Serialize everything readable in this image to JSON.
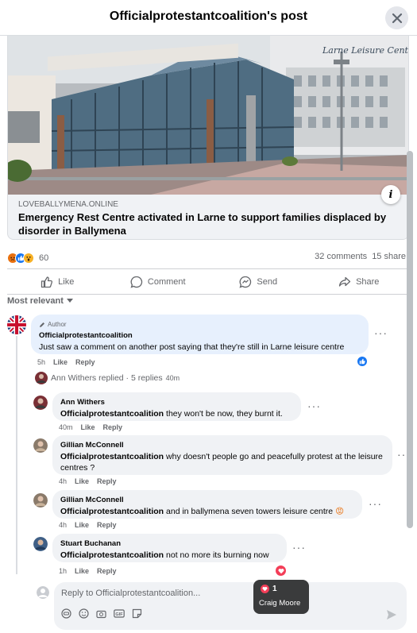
{
  "header": {
    "title": "Officialprotestantcoalition's post"
  },
  "card": {
    "image_sign": "Larne Leisure Centre",
    "domain": "LOVEBALLYMENA.ONLINE",
    "headline": "Emergency Rest Centre activated in Larne to support families displaced by disorder in Ballymena"
  },
  "reactions": {
    "count": "60",
    "comments": "32 comments",
    "shares": "15 share",
    "types": [
      "angry",
      "like",
      "wow"
    ]
  },
  "actions": {
    "like": "Like",
    "comment": "Comment",
    "send": "Send",
    "share": "Share"
  },
  "sort": {
    "label": "Most relevant"
  },
  "comments": [
    {
      "badge": "Author",
      "name": "Officialprotestantcoalition",
      "text": "Just saw a comment on another post saying that they're still in Larne leisure centre",
      "time": "5h",
      "like": "Like",
      "reply": "Reply"
    }
  ],
  "replies_summary": {
    "text": "Ann Withers replied · 5 replies",
    "time": "40m"
  },
  "replies": [
    {
      "name": "Ann Withers",
      "mention": "Officialprotestantcoalition",
      "text": " they won't be now, they burnt it.",
      "time": "40m",
      "like": "Like",
      "reply": "Reply"
    },
    {
      "name": "Gillian McConnell",
      "mention": "Officialprotestantcoalition",
      "text": " why doesn't people go and peacefully protest at the leisure centres ?",
      "time": "4h",
      "like": "Like",
      "reply": "Reply"
    },
    {
      "name": "Gillian McConnell",
      "mention": "Officialprotestantcoalition",
      "text": " and in ballymena seven towers leisure centre",
      "emoji": "😡",
      "time": "4h",
      "like": "Like",
      "reply": "Reply"
    },
    {
      "name": "Stuart Buchanan",
      "mention": "Officialprotestantcoalition",
      "text": " not no more its burning now",
      "time": "1h",
      "like": "Like",
      "reply": "Reply"
    }
  ],
  "reply_box": {
    "placeholder": "Reply to Officialprotestantcoalition..."
  },
  "tooltip": {
    "count": "1",
    "name": "Craig Moore"
  },
  "colors": {
    "like_blue": "#1877f2",
    "love_red": "#f33e58",
    "angry_orange": "#e9710f",
    "bubble": "#f0f2f5",
    "author_bubble": "#e7f0fd"
  }
}
